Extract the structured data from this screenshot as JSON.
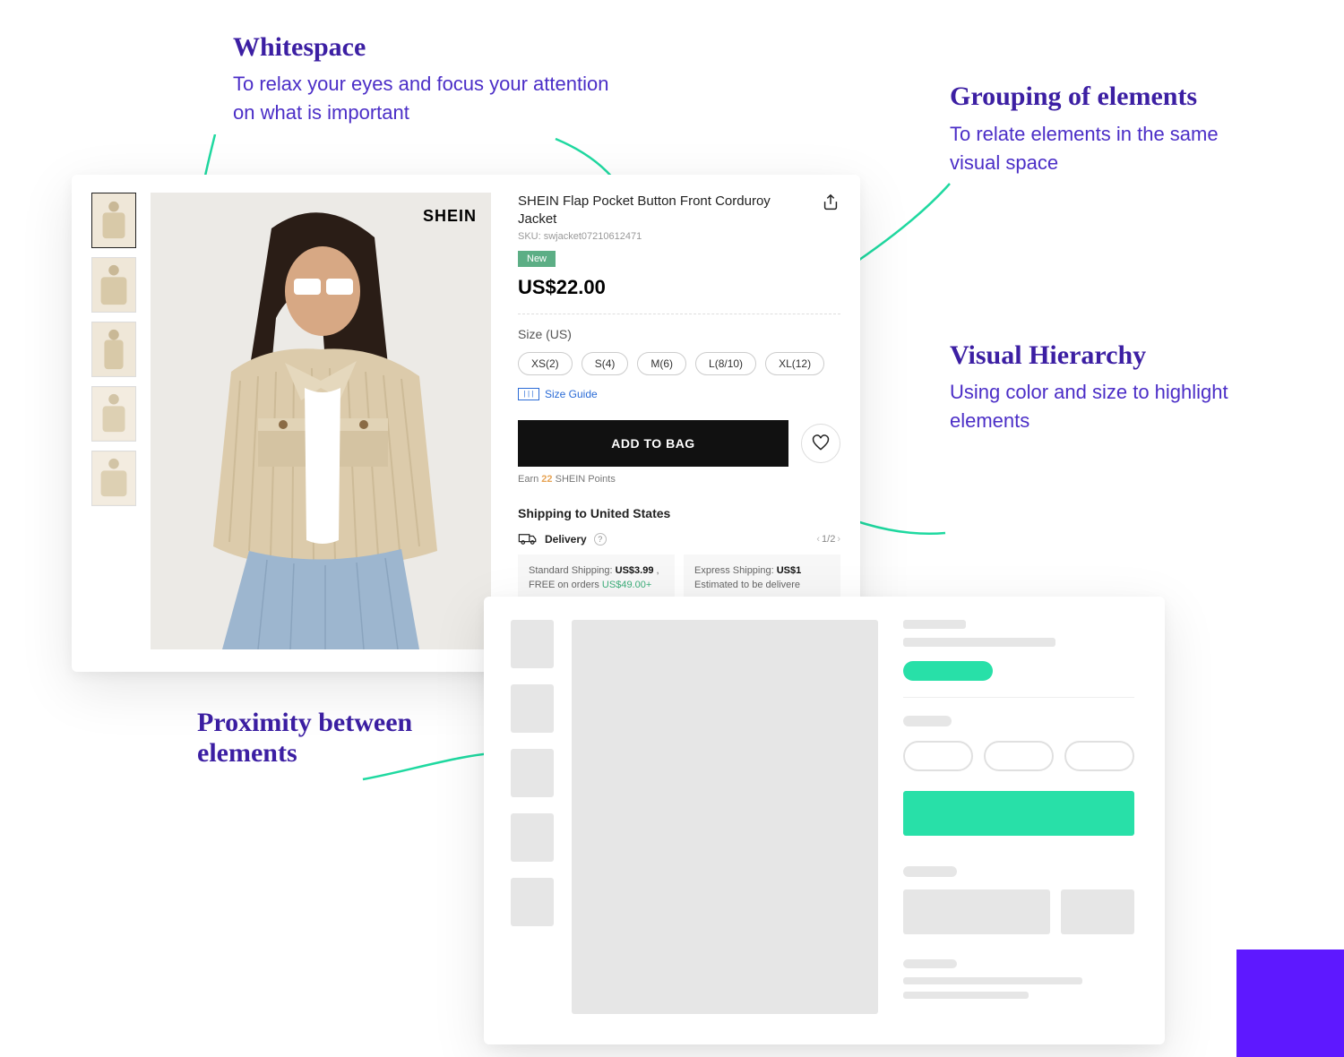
{
  "annotations": {
    "whitespace": {
      "title": "Whitespace",
      "body": "To relax your eyes and focus your attention on what is important"
    },
    "grouping": {
      "title": "Grouping of elements",
      "body": "To relate elements in the same visual space"
    },
    "hierarchy": {
      "title": "Visual Hierarchy",
      "body": "Using color and size to highlight elements"
    },
    "proximity": {
      "title": "Proximity between elements",
      "body": ""
    }
  },
  "product": {
    "brand_logo": "SHEIN",
    "title": "SHEIN Flap Pocket Button Front Corduroy Jacket",
    "sku_label": "SKU: swjacket07210612471",
    "badge": "New",
    "price": "US$22.00",
    "size_label": "Size",
    "size_region": "(US)",
    "sizes": [
      "XS(2)",
      "S(4)",
      "M(6)",
      "L(8/10)",
      "XL(12)"
    ],
    "size_guide": "Size Guide",
    "cta": "ADD TO BAG",
    "points_prefix": "Earn ",
    "points_count": "22",
    "points_suffix": " SHEIN Points",
    "shipping_heading": "Shipping to United States",
    "delivery_label": "Delivery",
    "pager": "1/2",
    "shipping_std": {
      "prefix": "Standard Shipping: ",
      "price": "US$3.99",
      "free_text": " , FREE on orders ",
      "threshold": "US$49.00+"
    },
    "shipping_exp": {
      "prefix": "Express Shipping: ",
      "price": "US$1",
      "line2": "Estimated to be delivere"
    }
  },
  "colors": {
    "heading_purple": "#3c1fa3",
    "body_purple": "#4b2ec7",
    "arrow_teal": "#1fd9a0",
    "badge_green": "#5cae85",
    "wire_teal": "#28e0a8",
    "block_purple": "#5e18ff"
  }
}
